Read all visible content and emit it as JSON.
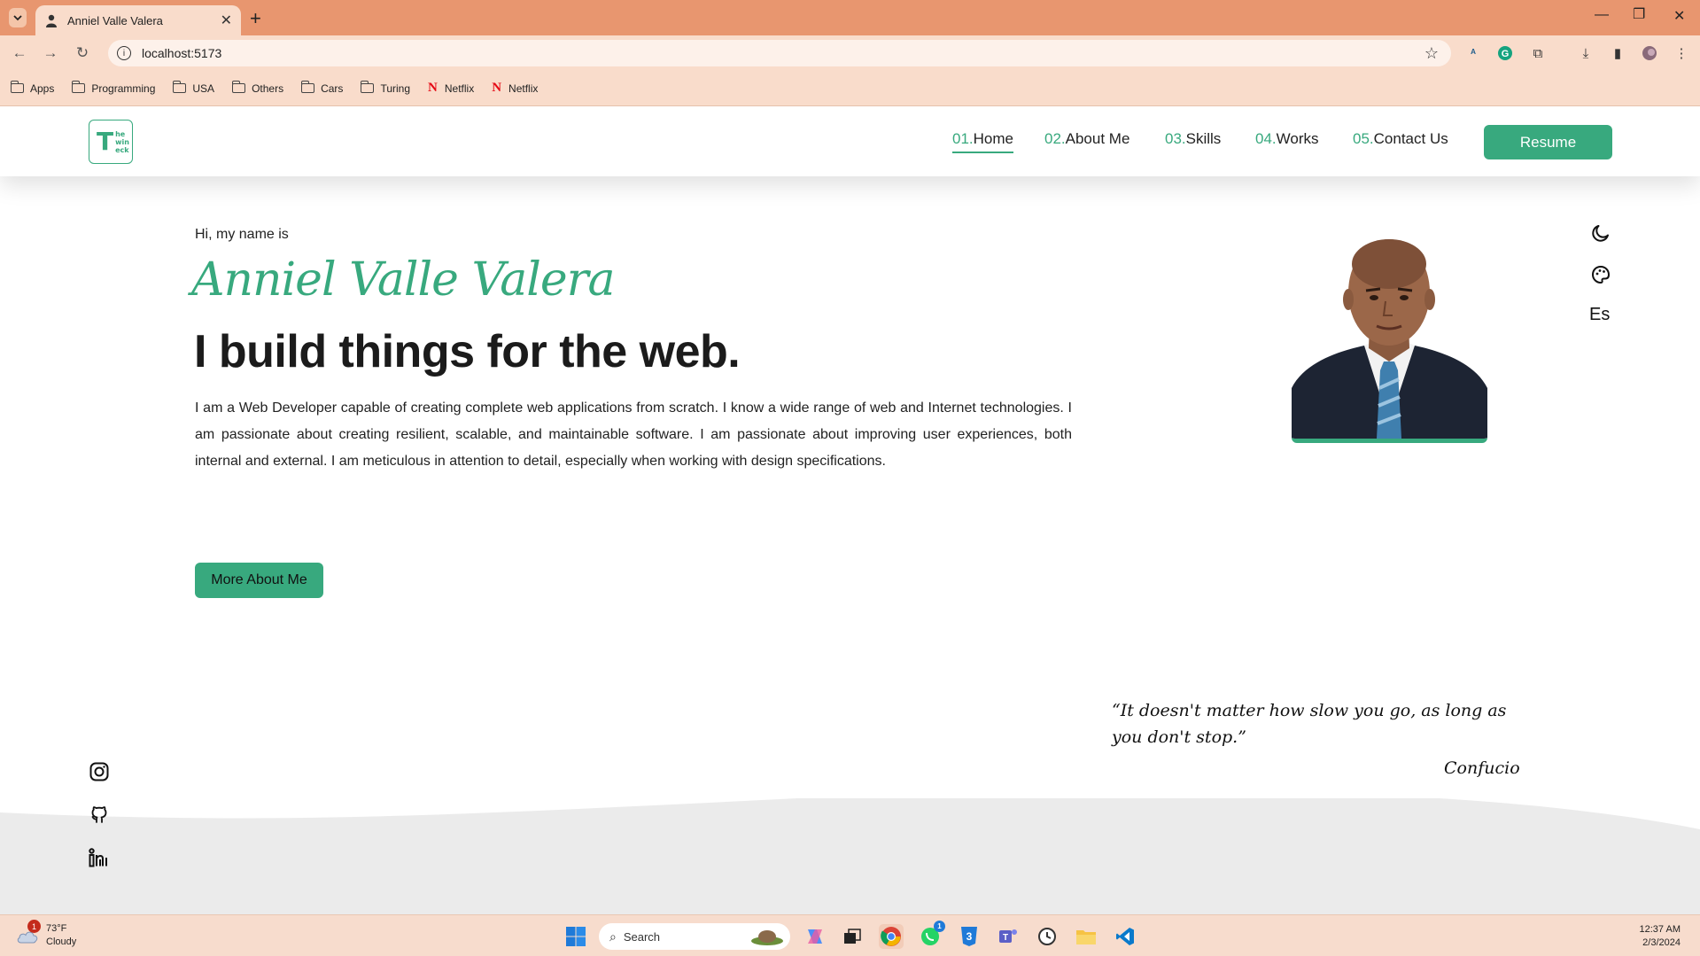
{
  "browser": {
    "tab_title": "Anniel Valle Valera",
    "url": "localhost:5173",
    "bookmarks": [
      {
        "type": "folder",
        "label": "Apps"
      },
      {
        "type": "folder",
        "label": "Programming"
      },
      {
        "type": "folder",
        "label": "USA"
      },
      {
        "type": "folder",
        "label": "Others"
      },
      {
        "type": "folder",
        "label": "Cars"
      },
      {
        "type": "folder",
        "label": "Turing"
      },
      {
        "type": "netflix",
        "label": "Netflix"
      },
      {
        "type": "netflix",
        "label": "Netflix"
      }
    ]
  },
  "header": {
    "logo": {
      "big": "T",
      "small": [
        "he",
        "win",
        "eck"
      ]
    },
    "nav": [
      {
        "num": "01.",
        "label": "Home",
        "active": true
      },
      {
        "num": "02.",
        "label": "About Me",
        "active": false
      },
      {
        "num": "03.",
        "label": "Skills",
        "active": false
      },
      {
        "num": "04.",
        "label": "Works",
        "active": false
      },
      {
        "num": "05.",
        "label": "Contact Us",
        "active": false
      }
    ],
    "resume_label": "Resume"
  },
  "hero": {
    "greeting": "Hi, my name is",
    "name": "Anniel Valle Valera",
    "headline": "I build things for the web.",
    "bio": "I am a Web Developer capable of creating complete web applications from scratch. I know a wide range of web and Internet technologies. I am passionate about creating resilient, scalable, and maintainable software. I am passionate about improving user experiences, both internal and external. I am meticulous in attention to detail, especially when working with design specifications.",
    "more_label": "More About Me"
  },
  "settings": {
    "language": "Es"
  },
  "quote": {
    "text": "“It doesn't matter how slow you go, as long as you don't stop.”",
    "author": "Confucio"
  },
  "taskbar": {
    "weather_temp": "73°F",
    "weather_desc": "Cloudy",
    "weather_badge": "1",
    "search_label": "Search",
    "whatsapp_badge": "1",
    "time": "12:37 AM",
    "date": "2/3/2024"
  },
  "colors": {
    "accent": "#38a97e",
    "chrome": "#e8966f",
    "chrome_light": "#f9dccb"
  }
}
